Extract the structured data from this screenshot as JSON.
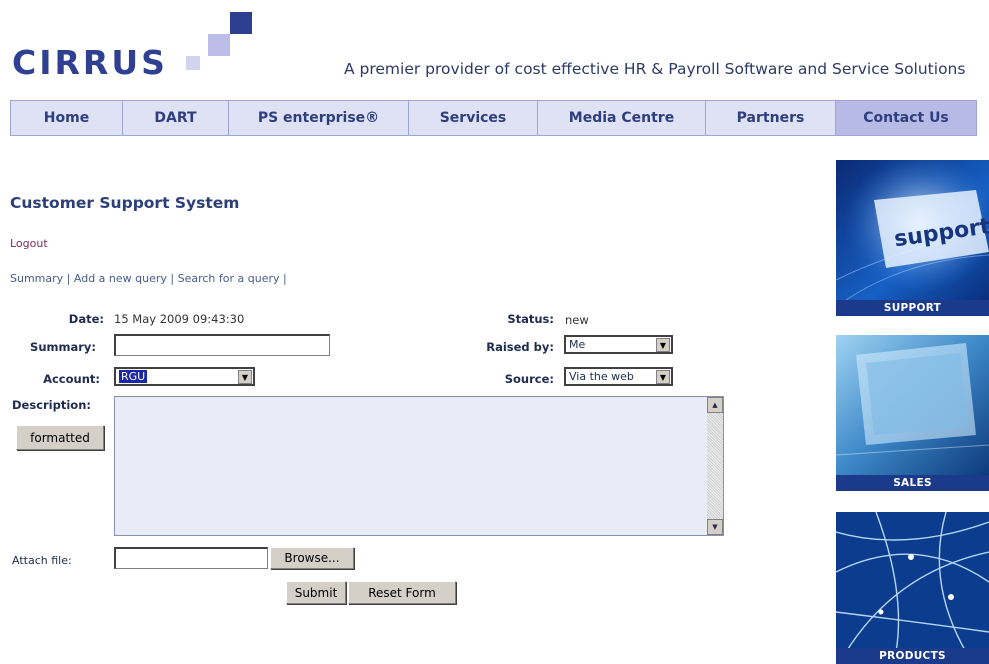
{
  "brand": {
    "logo_text": "CIRRUS",
    "tagline": "A premier provider of cost effective HR & Payroll Software and Service Solutions"
  },
  "nav": {
    "items": [
      "Home",
      "DART",
      "PS enterprise®",
      "Services",
      "Media Centre",
      "Partners",
      "Contact Us"
    ],
    "active": "Contact Us"
  },
  "page": {
    "title": "Customer Support System",
    "logout": "Logout",
    "subnav": [
      "Summary",
      "Add a new query",
      "Search for a query"
    ]
  },
  "form": {
    "date_label": "Date:",
    "date_value": "15 May 2009 09:43:30",
    "status_label": "Status:",
    "status_value": "new",
    "summary_label": "Summary:",
    "summary_value": "",
    "raised_by_label": "Raised by:",
    "raised_by_value": "Me",
    "account_label": "Account:",
    "account_value": "RGU",
    "source_label": "Source:",
    "source_value": "Via the web",
    "description_label": "Description:",
    "formatted_button": "formatted",
    "description_value": "",
    "attach_label": "Attach file:",
    "attach_value": "",
    "browse_button": "Browse...",
    "submit_button": "Submit",
    "reset_button": "Reset Form"
  },
  "banners": {
    "support": "SUPPORT",
    "support_image_text": "support",
    "sales": "SALES",
    "products": "PRODUCTS"
  },
  "colors": {
    "brand_blue": "#2f3f92",
    "nav_bg": "#dfe2f4",
    "nav_active": "#b7bae4",
    "banner_caption": "#1c3a8a"
  }
}
